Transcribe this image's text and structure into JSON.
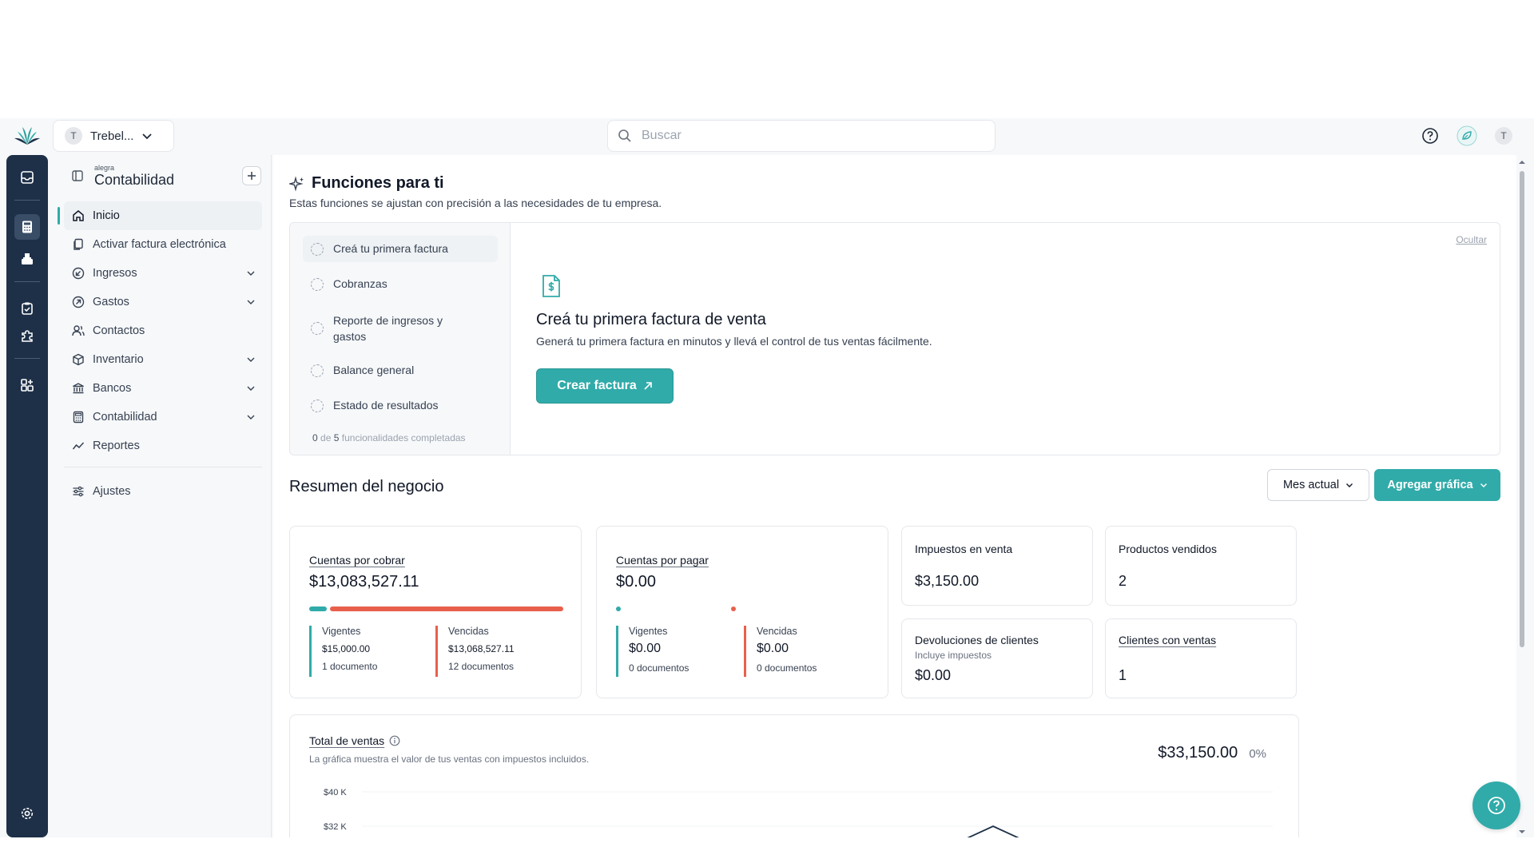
{
  "topbar": {
    "company_initial": "T",
    "company_name": "Trebel...",
    "search_placeholder": "Buscar",
    "user_initial": "T"
  },
  "sidebar": {
    "brand_small": "alegra",
    "brand_big": "Contabilidad",
    "items": [
      {
        "label": "Inicio",
        "icon": "home-icon",
        "active": true
      },
      {
        "label": "Activar factura electrónica",
        "icon": "document-copy-icon"
      },
      {
        "label": "Ingresos",
        "icon": "income-icon",
        "expandable": true
      },
      {
        "label": "Gastos",
        "icon": "expense-icon",
        "expandable": true
      },
      {
        "label": "Contactos",
        "icon": "contacts-icon"
      },
      {
        "label": "Inventario",
        "icon": "box-icon",
        "expandable": true
      },
      {
        "label": "Bancos",
        "icon": "bank-icon",
        "expandable": true
      },
      {
        "label": "Contabilidad",
        "icon": "calculator-icon",
        "expandable": true
      },
      {
        "label": "Reportes",
        "icon": "chart-line-icon"
      }
    ],
    "settings_label": "Ajustes"
  },
  "main": {
    "title": "Funciones para ti",
    "subtitle": "Estas funciones se ajustan con precisión a las necesidades de tu empresa.",
    "steps": [
      "Creá tu primera factura",
      "Cobranzas",
      "Reporte de ingresos y gastos",
      "Balance general",
      "Estado de resultados"
    ],
    "steps_done": "0",
    "steps_of": "de",
    "steps_total": "5",
    "steps_suffix": "funcionalidades completadas",
    "hide_label": "Ocultar",
    "feature_title": "Creá tu primera factura de venta",
    "feature_desc": "Generá tu primera factura en minutos y llevá el control de tus ventas fácilmente.",
    "create_button": "Crear factura",
    "summary_title": "Resumen del negocio",
    "period_button": "Mes actual",
    "add_chart_button": "Agregar gráfica"
  },
  "cards": {
    "receivable": {
      "title": "Cuentas por cobrar",
      "amount": "$13,083,527.11",
      "current_label": "Vigentes",
      "current_amount": "$15,000.00",
      "current_docs": "1 documento",
      "overdue_label": "Vencidas",
      "overdue_amount": "$13,068,527.11",
      "overdue_docs": "12 documentos",
      "current_fraction": 0.07
    },
    "payable": {
      "title": "Cuentas por pagar",
      "amount": "$0.00",
      "current_label": "Vigentes",
      "current_amount": "$0.00",
      "current_docs": "0 documentos",
      "overdue_label": "Vencidas",
      "overdue_amount": "$0.00",
      "overdue_docs": "0 documentos"
    },
    "sales_tax": {
      "title": "Impuestos en venta",
      "amount": "$3,150.00"
    },
    "products_sold": {
      "title": "Productos vendidos",
      "amount": "2"
    },
    "returns": {
      "title": "Devoluciones de clientes",
      "note": "Incluye impuestos",
      "amount": "$0.00"
    },
    "customers": {
      "title": "Clientes con ventas",
      "amount": "1"
    }
  },
  "sales_chart": {
    "title": "Total de ventas",
    "description": "La gráfica muestra el valor de tus ventas con impuestos incluidos.",
    "total": "$33,150.00",
    "change": "0%"
  },
  "chart_data": {
    "type": "line",
    "y_ticks": [
      "$40 K",
      "$32 K"
    ]
  },
  "colors": {
    "accent": "#30aba9",
    "rail": "#1e3048",
    "overdue": "#e8604c"
  }
}
